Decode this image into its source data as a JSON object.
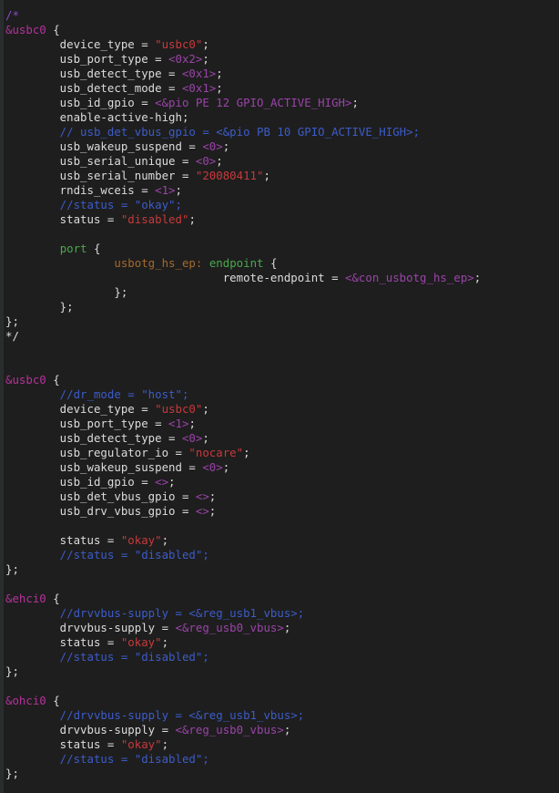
{
  "colors": {
    "background": "#1e1e1e",
    "plain": "#dcdcdc",
    "comment": "#3c5cc9",
    "string": "#c8393b",
    "angle_value": "#9a44a8",
    "node_ref": "#b4329a",
    "label": "#a46a2c",
    "keyword": "#49a94b"
  },
  "lines": [
    [
      [
        "comment-purple",
        "/*"
      ]
    ],
    [
      [
        "ref",
        "&usbc0"
      ],
      [
        "plain",
        " {"
      ]
    ],
    [
      [
        "plain",
        "        device_type = "
      ],
      [
        "string",
        "\"usbc0\""
      ],
      [
        "plain",
        ";"
      ]
    ],
    [
      [
        "plain",
        "        usb_port_type = "
      ],
      [
        "angle",
        "<0x2>"
      ],
      [
        "plain",
        ";"
      ]
    ],
    [
      [
        "plain",
        "        usb_detect_type = "
      ],
      [
        "angle",
        "<0x1>"
      ],
      [
        "plain",
        ";"
      ]
    ],
    [
      [
        "plain",
        "        usb_detect_mode = "
      ],
      [
        "angle",
        "<0x1>"
      ],
      [
        "plain",
        ";"
      ]
    ],
    [
      [
        "plain",
        "        usb_id_gpio = "
      ],
      [
        "angle",
        "<&pio PE 12 GPIO_ACTIVE_HIGH>"
      ],
      [
        "plain",
        ";"
      ]
    ],
    [
      [
        "plain",
        "        enable-active-high;"
      ]
    ],
    [
      [
        "comment",
        "        // usb_det_vbus_gpio = <&pio PB 10 GPIO_ACTIVE_HIGH>;"
      ]
    ],
    [
      [
        "plain",
        "        usb_wakeup_suspend = "
      ],
      [
        "angle",
        "<0>"
      ],
      [
        "plain",
        ";"
      ]
    ],
    [
      [
        "plain",
        "        usb_serial_unique = "
      ],
      [
        "angle",
        "<0>"
      ],
      [
        "plain",
        ";"
      ]
    ],
    [
      [
        "plain",
        "        usb_serial_number = "
      ],
      [
        "string",
        "\"20080411\""
      ],
      [
        "plain",
        ";"
      ]
    ],
    [
      [
        "plain",
        "        rndis_wceis = "
      ],
      [
        "angle",
        "<1>"
      ],
      [
        "plain",
        ";"
      ]
    ],
    [
      [
        "comment",
        "        //status = \"okay\";"
      ]
    ],
    [
      [
        "plain",
        "        status = "
      ],
      [
        "string",
        "\"disabled\""
      ],
      [
        "plain",
        ";"
      ]
    ],
    [],
    [
      [
        "plain",
        "        "
      ],
      [
        "keyword",
        "port"
      ],
      [
        "plain",
        " {"
      ]
    ],
    [
      [
        "plain",
        "                "
      ],
      [
        "label",
        "usbotg_hs_ep:"
      ],
      [
        "plain",
        " "
      ],
      [
        "keyword",
        "endpoint"
      ],
      [
        "plain",
        " {"
      ]
    ],
    [
      [
        "plain",
        "                                remote-endpoint = "
      ],
      [
        "angle",
        "<&con_usbotg_hs_ep>"
      ],
      [
        "plain",
        ";"
      ]
    ],
    [
      [
        "plain",
        "                };"
      ]
    ],
    [
      [
        "plain",
        "        };"
      ]
    ],
    [
      [
        "plain",
        "};"
      ]
    ],
    [
      [
        "plain",
        "*/"
      ]
    ],
    [],
    [],
    [
      [
        "ref",
        "&usbc0"
      ],
      [
        "plain",
        " {"
      ]
    ],
    [
      [
        "comment",
        "        //dr_mode = \"host\";"
      ]
    ],
    [
      [
        "plain",
        "        device_type = "
      ],
      [
        "string",
        "\"usbc0\""
      ],
      [
        "plain",
        ";"
      ]
    ],
    [
      [
        "plain",
        "        usb_port_type = "
      ],
      [
        "angle",
        "<1>"
      ],
      [
        "plain",
        ";"
      ]
    ],
    [
      [
        "plain",
        "        usb_detect_type = "
      ],
      [
        "angle",
        "<0>"
      ],
      [
        "plain",
        ";"
      ]
    ],
    [
      [
        "plain",
        "        usb_regulator_io = "
      ],
      [
        "string",
        "\"nocare\""
      ],
      [
        "plain",
        ";"
      ]
    ],
    [
      [
        "plain",
        "        usb_wakeup_suspend = "
      ],
      [
        "angle",
        "<0>"
      ],
      [
        "plain",
        ";"
      ]
    ],
    [
      [
        "plain",
        "        usb_id_gpio = "
      ],
      [
        "angle",
        "<>"
      ],
      [
        "plain",
        ";"
      ]
    ],
    [
      [
        "plain",
        "        usb_det_vbus_gpio = "
      ],
      [
        "angle",
        "<>"
      ],
      [
        "plain",
        ";"
      ]
    ],
    [
      [
        "plain",
        "        usb_drv_vbus_gpio = "
      ],
      [
        "angle",
        "<>"
      ],
      [
        "plain",
        ";"
      ]
    ],
    [],
    [
      [
        "plain",
        "        status = "
      ],
      [
        "string",
        "\"okay\""
      ],
      [
        "plain",
        ";"
      ]
    ],
    [
      [
        "comment",
        "        //status = \"disabled\";"
      ]
    ],
    [
      [
        "plain",
        "};"
      ]
    ],
    [],
    [
      [
        "ref",
        "&ehci0"
      ],
      [
        "plain",
        " {"
      ]
    ],
    [
      [
        "comment",
        "        //drvvbus-supply = <&reg_usb1_vbus>;"
      ]
    ],
    [
      [
        "plain",
        "        drvvbus-supply = "
      ],
      [
        "angle",
        "<&reg_usb0_vbus>"
      ],
      [
        "plain",
        ";"
      ]
    ],
    [
      [
        "plain",
        "        status = "
      ],
      [
        "string",
        "\"okay\""
      ],
      [
        "plain",
        ";"
      ]
    ],
    [
      [
        "comment",
        "        //status = \"disabled\";"
      ]
    ],
    [
      [
        "plain",
        "};"
      ]
    ],
    [],
    [
      [
        "ref",
        "&ohci0"
      ],
      [
        "plain",
        " {"
      ]
    ],
    [
      [
        "comment",
        "        //drvvbus-supply = <&reg_usb1_vbus>;"
      ]
    ],
    [
      [
        "plain",
        "        drvvbus-supply = "
      ],
      [
        "angle",
        "<&reg_usb0_vbus>"
      ],
      [
        "plain",
        ";"
      ]
    ],
    [
      [
        "plain",
        "        status = "
      ],
      [
        "string",
        "\"okay\""
      ],
      [
        "plain",
        ";"
      ]
    ],
    [
      [
        "comment",
        "        //status = \"disabled\";"
      ]
    ],
    [
      [
        "plain",
        "};"
      ]
    ]
  ]
}
